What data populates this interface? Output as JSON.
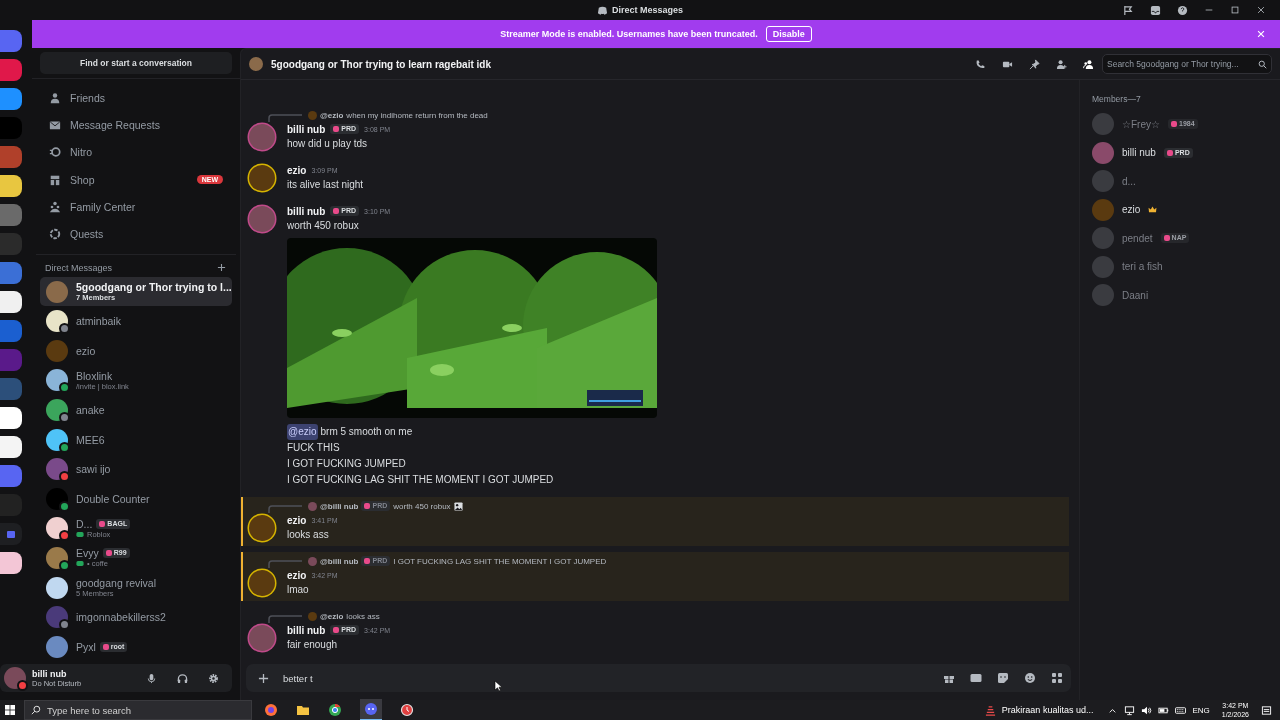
{
  "title_bar": {
    "title": "Direct Messages"
  },
  "banner": {
    "text": "Streamer Mode is enabled. Usernames have been truncated.",
    "button": "Disable"
  },
  "servers": [
    {
      "color": "#5865f2",
      "kind": "home"
    },
    {
      "color": "#e0184a",
      "kind": "app"
    },
    {
      "color": "#1e90ff",
      "kind": "app"
    },
    {
      "color": "#000000",
      "kind": "app"
    },
    {
      "color": "#b0402a",
      "kind": "app"
    },
    {
      "color": "#e8c640",
      "kind": "app"
    },
    {
      "color": "#6a6a6a",
      "kind": "app"
    },
    {
      "color": "#2b2b2b",
      "kind": "app"
    },
    {
      "color": "#3b6fd6",
      "kind": "app"
    },
    {
      "color": "#f0f0f0",
      "kind": "app"
    },
    {
      "color": "#1b5fd0",
      "kind": "app"
    },
    {
      "color": "#5a1a8a",
      "kind": "app"
    },
    {
      "color": "#2c4f7a",
      "kind": "app"
    },
    {
      "color": "#ffffff",
      "kind": "app"
    },
    {
      "color": "#f4f4f4",
      "kind": "app"
    },
    {
      "color": "#5865f2",
      "kind": "app"
    },
    {
      "color": "#222222",
      "kind": "app"
    },
    {
      "color": "#1e1f22",
      "kind": "folder"
    },
    {
      "color": "#f3c6d6",
      "kind": "app"
    }
  ],
  "sidebar": {
    "search": "Find or start a conversation",
    "nav": [
      {
        "label": "Friends",
        "kind": "friends"
      },
      {
        "label": "Message Requests",
        "kind": "mail"
      },
      {
        "label": "Nitro",
        "kind": "nitro"
      },
      {
        "label": "Shop",
        "kind": "shop",
        "badge": "NEW"
      },
      {
        "label": "Family Center",
        "kind": "family"
      },
      {
        "label": "Quests",
        "kind": "quests"
      }
    ],
    "dm_header": "Direct Messages",
    "dms": [
      {
        "name": "5goodgang or Thor trying to l...",
        "sub": "7 Members",
        "selected": true
      },
      {
        "name": "atminbaik",
        "selected": false,
        "color": "#80848e"
      },
      {
        "name": "ezio",
        "selected": false
      },
      {
        "name": "Bloxlink",
        "sub": "/invite | blox.link",
        "selected": false,
        "color": "#23a55a"
      },
      {
        "name": "anake",
        "selected": false,
        "color": "#80848e"
      },
      {
        "name": "MEE6",
        "selected": false,
        "color": "#23a55a"
      },
      {
        "name": "sawi ijo",
        "selected": false,
        "color": "#f23f43"
      },
      {
        "name": "Double Counter",
        "selected": false,
        "color": "#23a55a"
      },
      {
        "name": "D...",
        "tag": "BAGL",
        "sub": "Roblox",
        "game": true,
        "selected": false,
        "color": "#f23f43"
      },
      {
        "name": "Evyy",
        "tag": "R99",
        "sub": "• coffe",
        "game": true,
        "selected": false,
        "color": "#23a55a"
      },
      {
        "name": "goodgang revival",
        "sub": "5 Members",
        "selected": false
      },
      {
        "name": "imgonnabekillerss2",
        "selected": false,
        "color": "#80848e"
      },
      {
        "name": "Pyxl",
        "tag": "root",
        "selected": false
      }
    ]
  },
  "user_panel": {
    "name": "billi nub",
    "status": "Do Not Disturb"
  },
  "channel": {
    "title": "5goodgang or Thor trying to learn ragebait idk",
    "search_placeholder": "Search 5goodgang or Thor trying..."
  },
  "messages": [
    {
      "author": "billi nub",
      "tag": "PRD",
      "time": "3:08 PM",
      "mentioned": false,
      "reply": {
        "author": "@ezio",
        "text": "when my indihome return from the dead"
      },
      "lines": [
        {
          "text": "how did u play tds"
        }
      ]
    },
    {
      "author": "ezio",
      "time": "3:09 PM",
      "mentioned": false,
      "lines": [
        {
          "text": "its alive last night"
        }
      ]
    },
    {
      "author": "billi nub",
      "tag": "PRD",
      "time": "3:10 PM",
      "mentioned": false,
      "lines": [
        {
          "text": "worth 450 robux"
        }
      ],
      "after": [
        {
          "mention": "@ezio",
          "text": "brm 5 smooth on me"
        },
        {
          "text": "FUCK THIS"
        },
        {
          "text": "I GOT FUCKING JUMPED"
        },
        {
          "text": "I GOT FUCKING LAG SHIT THE MOMENT I GOT JUMPED"
        }
      ]
    },
    {
      "author": "ezio",
      "time": "3:41 PM",
      "mentioned": true,
      "reply": {
        "author": "@billi nub",
        "tag": "PRD",
        "text": "worth 450 robux",
        "has_image": true
      },
      "lines": [
        {
          "text": "looks ass"
        }
      ]
    },
    {
      "author": "ezio",
      "time": "3:42 PM",
      "mentioned": true,
      "reply": {
        "author": "@billi nub",
        "tag": "PRD",
        "text": "I GOT FUCKING LAG SHIT THE MOMENT I GOT JUMPED"
      },
      "lines": [
        {
          "text": "lmao"
        }
      ]
    },
    {
      "author": "billi nub",
      "tag": "PRD",
      "time": "3:42 PM",
      "mentioned": false,
      "reply": {
        "author": "@ezio",
        "text": "looks ass"
      },
      "lines": [
        {
          "text": "fair enough"
        }
      ]
    }
  ],
  "composer": {
    "value": "better t"
  },
  "members": {
    "header": "Members—7",
    "items": [
      {
        "name": "☆Frey☆",
        "tag": "1984",
        "offline": true
      },
      {
        "name": "billi nub",
        "tag": "PRD",
        "offline": false
      },
      {
        "name": "d...",
        "offline": true
      },
      {
        "name": "ezio",
        "crown": true,
        "offline": false
      },
      {
        "name": "pendet",
        "tag": "NAP",
        "offline": true
      },
      {
        "name": "teri a fish",
        "offline": true
      },
      {
        "name": "Daani",
        "offline": true
      }
    ]
  },
  "taskbar": {
    "search_placeholder": "Type here to search",
    "weather": "Prakiraan kualitas ud...",
    "lang": "ENG",
    "time": "3:42 PM",
    "date": "1/2/2026"
  }
}
